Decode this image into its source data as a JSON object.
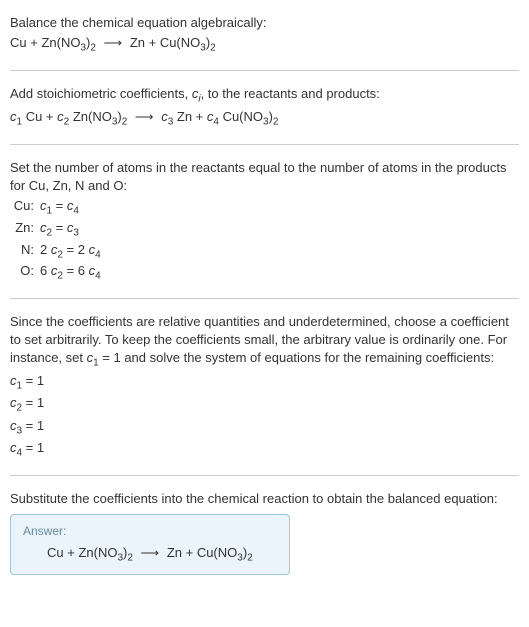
{
  "intro": {
    "title": "Balance the chemical equation algebraically:"
  },
  "step1": {
    "text": "Add stoichiometric coefficients, ",
    "ci": "c",
    "ci_sub": "i",
    "text2": ", to the reactants and products:"
  },
  "step2": {
    "text": "Set the number of atoms in the reactants equal to the number of atoms in the products for Cu, Zn, N and O:",
    "rows": [
      {
        "el": "Cu:",
        "lhs_c": "c",
        "lhs_n": "1",
        "eq": " = ",
        "rhs_c": "c",
        "rhs_n": "4",
        "lhs_k": "",
        "rhs_k": ""
      },
      {
        "el": "Zn:",
        "lhs_c": "c",
        "lhs_n": "2",
        "eq": " = ",
        "rhs_c": "c",
        "rhs_n": "3",
        "lhs_k": "",
        "rhs_k": ""
      },
      {
        "el": "N:",
        "lhs_c": "c",
        "lhs_n": "2",
        "eq": " = ",
        "rhs_c": "c",
        "rhs_n": "4",
        "lhs_k": "2 ",
        "rhs_k": "2 "
      },
      {
        "el": "O:",
        "lhs_c": "c",
        "lhs_n": "2",
        "eq": " = ",
        "rhs_c": "c",
        "rhs_n": "4",
        "lhs_k": "6 ",
        "rhs_k": "6 "
      }
    ]
  },
  "step3": {
    "text1": "Since the coefficients are relative quantities and underdetermined, choose a coefficient to set arbitrarily. To keep the coefficients small, the arbitrary value is ordinarily one. For instance, set ",
    "c": "c",
    "c1": "1",
    "text2": " = 1 and solve the system of equations for the remaining coefficients:",
    "solutions": [
      {
        "c": "c",
        "n": "1",
        "val": " = 1"
      },
      {
        "c": "c",
        "n": "2",
        "val": " = 1"
      },
      {
        "c": "c",
        "n": "3",
        "val": " = 1"
      },
      {
        "c": "c",
        "n": "4",
        "val": " = 1"
      }
    ]
  },
  "step4": {
    "text": "Substitute the coefficients into the chemical reaction to obtain the balanced equation:"
  },
  "answer": {
    "label": "Answer:"
  },
  "chem": {
    "Cu": "Cu",
    "Zn": "Zn",
    "plus": " + ",
    "ZnNO3": "Zn(NO",
    "CuNO3": "Cu(NO",
    "three": "3",
    "close": ")",
    "two": "2",
    "arrow": "⟶",
    "c": "c",
    "n1": "1",
    "n2": "2",
    "n3": "3",
    "n4": "4",
    "sp": " "
  }
}
